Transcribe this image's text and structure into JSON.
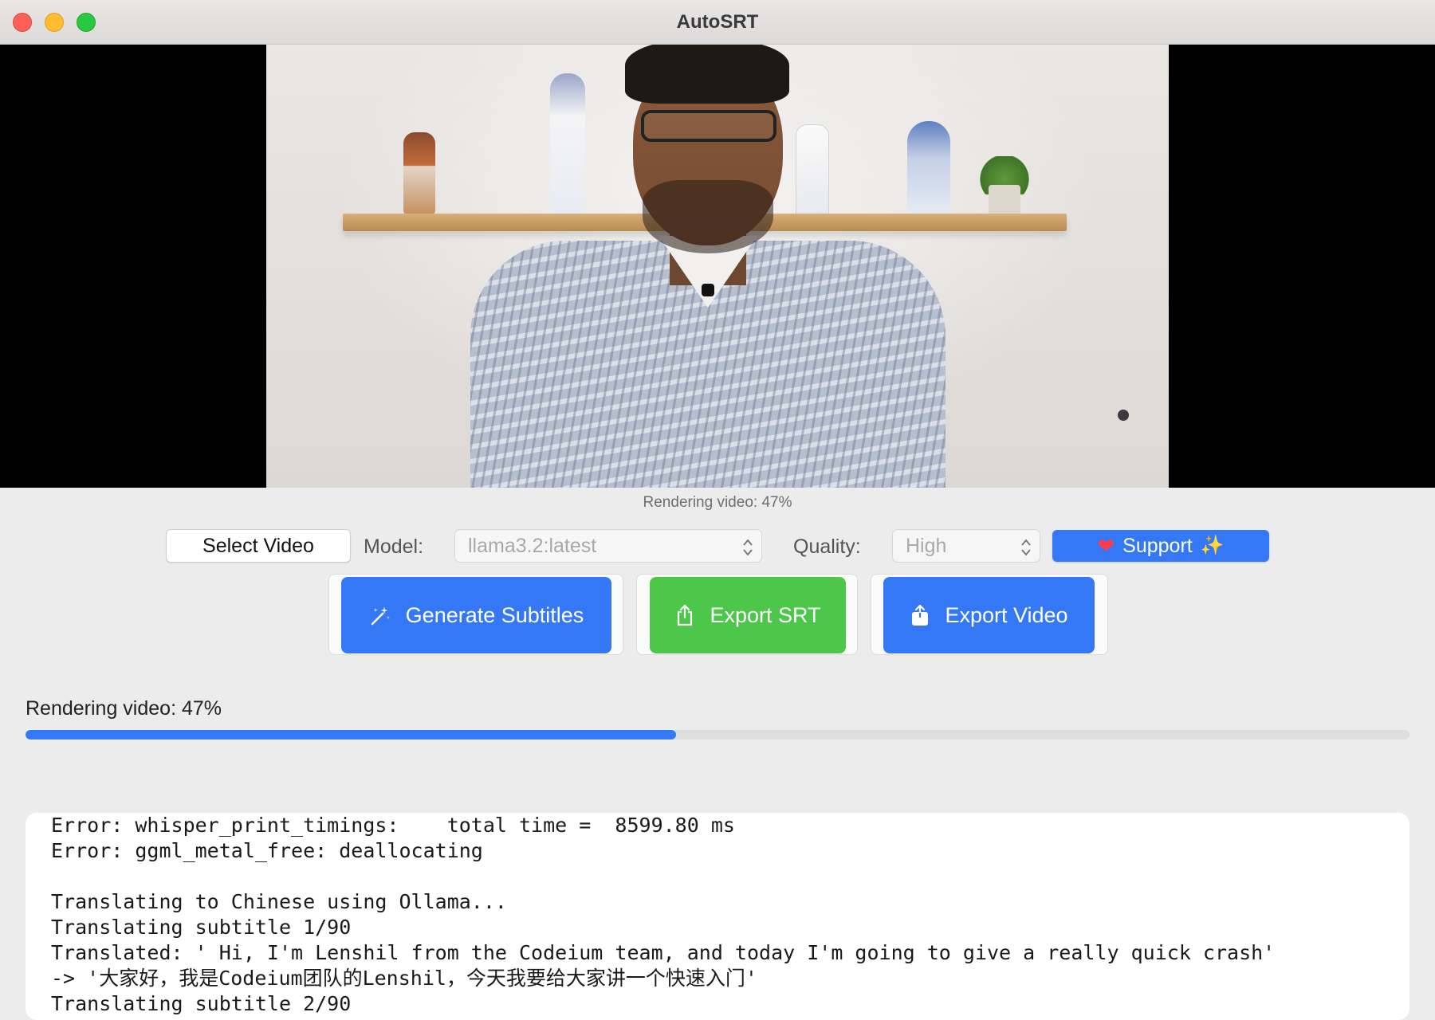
{
  "window": {
    "title": "AutoSRT"
  },
  "video": {
    "status_caption": "Rendering video: 47%"
  },
  "controls": {
    "select_video_label": "Select Video",
    "model_label": "Model:",
    "model_value": "llama3.2:latest",
    "quality_label": "Quality:",
    "quality_value": "High",
    "support_label": "Support"
  },
  "actions": {
    "generate_label": "Generate Subtitles",
    "export_srt_label": "Export SRT",
    "export_video_label": "Export Video"
  },
  "progress": {
    "label": "Rendering video: 47%",
    "fraction": 0.47
  },
  "log": {
    "lines": [
      "Error: whisper_print_timings:    total time =  8599.80 ms",
      "Error: ggml_metal_free: deallocating",
      "",
      "Translating to Chinese using Ollama...",
      "Translating subtitle 1/90",
      "Translated: ' Hi, I'm Lenshil from the Codeium team, and today I'm going to give a really quick crash'",
      "-> '大家好，我是Codeium团队的Lenshil，今天我要给大家讲一个快速入门'",
      "Translating subtitle 2/90"
    ]
  },
  "icons": {
    "close": "close-button",
    "minimize": "minimize-button",
    "zoom": "zoom-button",
    "heart": "heart-icon",
    "sparkles": "sparkles-icon",
    "magic_wand": "magic-wand-icon",
    "share_outline": "share-icon",
    "share_filled": "share-filled-icon",
    "updown": "chevron-updown-icon"
  },
  "colors": {
    "accent_blue": "#3478f6",
    "export_green": "#4cc74a",
    "heart_red": "#ff3b4a"
  }
}
